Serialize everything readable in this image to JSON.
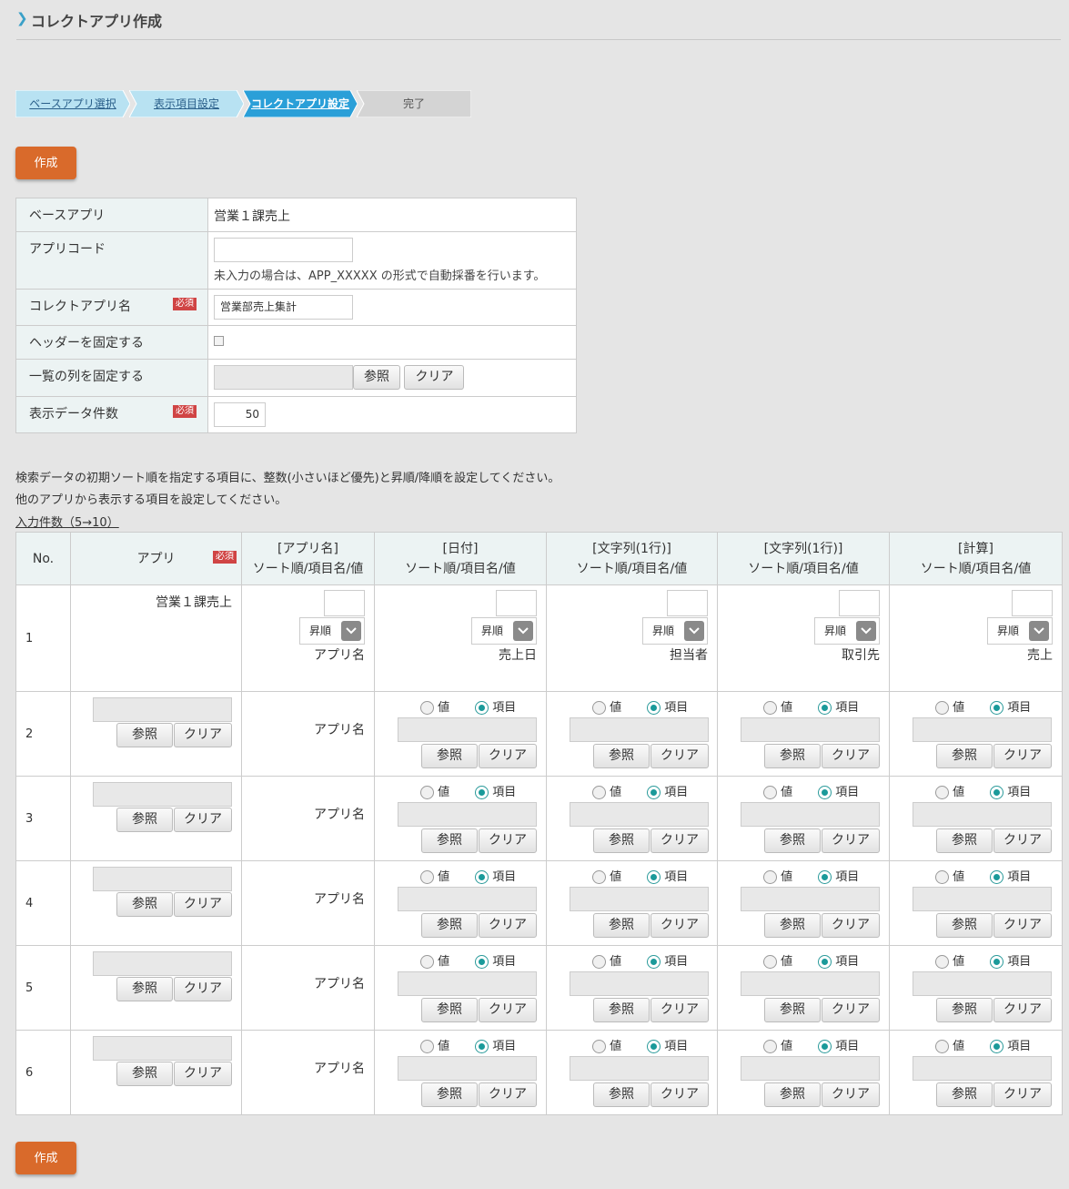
{
  "title": "コレクトアプリ作成",
  "steps": [
    {
      "label": "ベースアプリ選択",
      "state": "done"
    },
    {
      "label": "表示項目設定",
      "state": "done"
    },
    {
      "label": "コレクトアプリ設定",
      "state": "current"
    },
    {
      "label": "完了",
      "state": "todo"
    }
  ],
  "create_label": "作成",
  "required_label": "必須",
  "browse_label": "参照",
  "clear_label": "クリア",
  "form": {
    "base_app_label": "ベースアプリ",
    "base_app_value": "営業１課売上",
    "app_code_label": "アプリコード",
    "app_code_value": "",
    "app_code_note": "未入力の場合は、APP_XXXXX の形式で自動採番を行います。",
    "collect_name_label": "コレクトアプリ名",
    "collect_name_value": "営業部売上集計",
    "fix_header_label": "ヘッダーを固定する",
    "fix_header_checked": false,
    "fix_columns_label": "一覧の列を固定する",
    "fix_columns_value": "",
    "display_count_label": "表示データ件数",
    "display_count_value": "50"
  },
  "descriptions": [
    "検索データの初期ソート順を指定する項目に、整数(小さいほど優先)と昇順/降順を設定してください。",
    "他のアプリから表示する項目を設定してください。"
  ],
  "input_count": "入力件数（5→10）",
  "grid": {
    "col_no": "No.",
    "col_app": "アプリ",
    "col_sub": "ソート順/項目名/値",
    "columns": [
      "[アプリ名]",
      "[日付]",
      "[文字列(1行)]",
      "[文字列(1行)]",
      "[計算]"
    ],
    "row1": {
      "no": "1",
      "app": "営業１課売上",
      "sort_order": "昇順",
      "fields": [
        "アプリ名",
        "売上日",
        "担当者",
        "取引先",
        "売上"
      ]
    },
    "rows": [
      {
        "no": "2",
        "app_name_label": "アプリ名"
      },
      {
        "no": "3",
        "app_name_label": "アプリ名"
      },
      {
        "no": "4",
        "app_name_label": "アプリ名"
      },
      {
        "no": "5",
        "app_name_label": "アプリ名"
      },
      {
        "no": "6",
        "app_name_label": "アプリ名"
      }
    ],
    "radio_value_label": "値",
    "radio_field_label": "項目",
    "radio_selected": "項目"
  },
  "colors": {
    "accent_orange": "#d96a2b",
    "step_done": "#b8e2f2",
    "step_current": "#2a9fd8",
    "step_todo": "#d4d4d4",
    "required_red": "#d04444",
    "header_bg": "#ecf3f3"
  }
}
